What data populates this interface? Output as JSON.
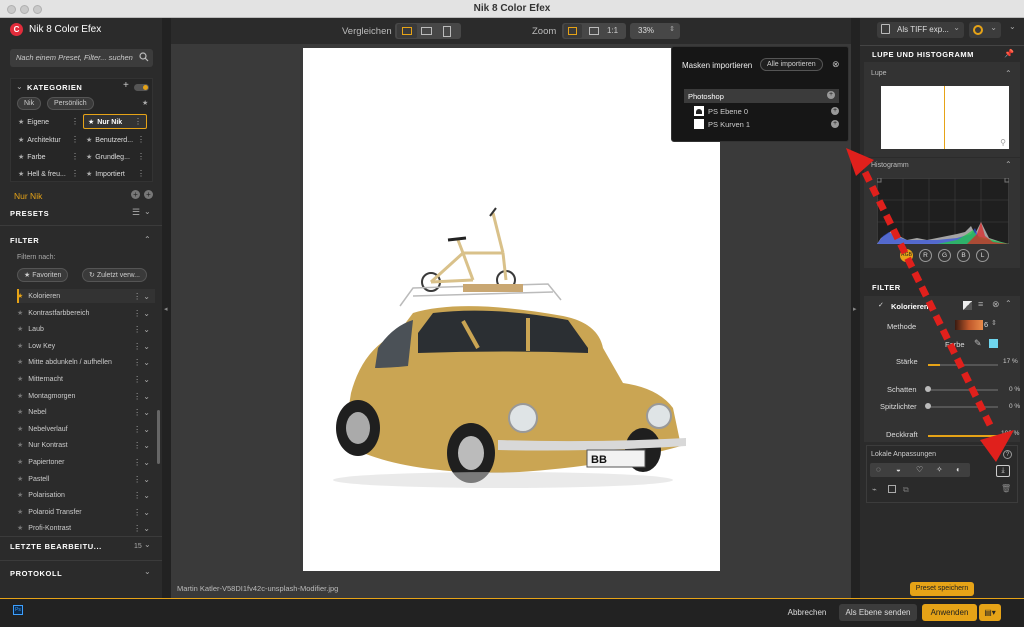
{
  "window": {
    "title": "Nik 8 Color Efex"
  },
  "left": {
    "app_name": "Nik 8 Color Efex",
    "search_placeholder": "Nach einem Preset, Filter... suchen",
    "kategorien_label": "KATEGORIEN",
    "tags": [
      "Nik",
      "Persönlich"
    ],
    "categories": [
      {
        "label": "Eigene"
      },
      {
        "label": "Nur Nik"
      },
      {
        "label": "Architektur"
      },
      {
        "label": "Benutzerd..."
      },
      {
        "label": "Farbe"
      },
      {
        "label": "Grundleg..."
      },
      {
        "label": "Hell & freu..."
      },
      {
        "label": "Importiert"
      }
    ],
    "selected_category": "Nur Nik",
    "presets_label": "PRESETS",
    "filter_label": "FILTER",
    "filter_by": "Filtern nach:",
    "filter_pills": [
      "Favoriten",
      "Zuletzt verw..."
    ],
    "filters": [
      "Kolorieren",
      "Kontrastfarbbereich",
      "Laub",
      "Low Key",
      "Mitte abdunkeln / aufhellen",
      "Mitternacht",
      "Montagmorgen",
      "Nebel",
      "Nebelverlauf",
      "Nur Kontrast",
      "Papiertoner",
      "Pastell",
      "Polarisation",
      "Polaroid Transfer",
      "Profi-Kontrast"
    ],
    "recent_label": "LETZTE BEARBEITU...",
    "recent_count": "15",
    "protocol_label": "PROTOKOLL"
  },
  "toolbar": {
    "compare_label": "Vergleichen",
    "zoom_label": "Zoom",
    "zoom_1to1": "1:1",
    "zoom_value": "33%"
  },
  "canvas": {
    "filename": "Martin Katler-V58DI1fv42c-unsplash-Modifier.jpg",
    "plate": "BB"
  },
  "masks": {
    "title": "Masken importieren",
    "import_all": "Alle importieren",
    "source": "Photoshop",
    "layers": [
      "PS Ebene 0",
      "PS Kurven 1"
    ]
  },
  "right": {
    "export_label": "Als TIFF exp...",
    "lupe_hist_label": "LUPE UND HISTOGRAMM",
    "lupe_label": "Lupe",
    "hist_label": "Histogramm",
    "channels": [
      "RGB",
      "R",
      "G",
      "B",
      "L"
    ],
    "filter_label": "FILTER",
    "filter_name": "Kolorieren",
    "method_label": "Methode",
    "method_value": "6",
    "color_label": "Farbe",
    "strength_label": "Stärke",
    "strength_value": "17 %",
    "strength": 0.17,
    "shadows_label": "Schatten",
    "shadows_value": "0 %",
    "highlights_label": "Spitzlichter",
    "highlights_value": "0 %",
    "opacity_label": "Deckkraft",
    "opacity_value": "100 %",
    "opacity": 1.0,
    "local_label": "Lokale Anpassungen",
    "save_preset": "Preset speichern"
  },
  "bottom": {
    "ps_badge": "Ps",
    "cancel": "Abbrechen",
    "send_layer": "Als Ebene senden",
    "apply": "Anwenden"
  },
  "colors": {
    "accent": "#e6a317",
    "brand": "#e22c3b",
    "arrow": "#e0201c"
  }
}
